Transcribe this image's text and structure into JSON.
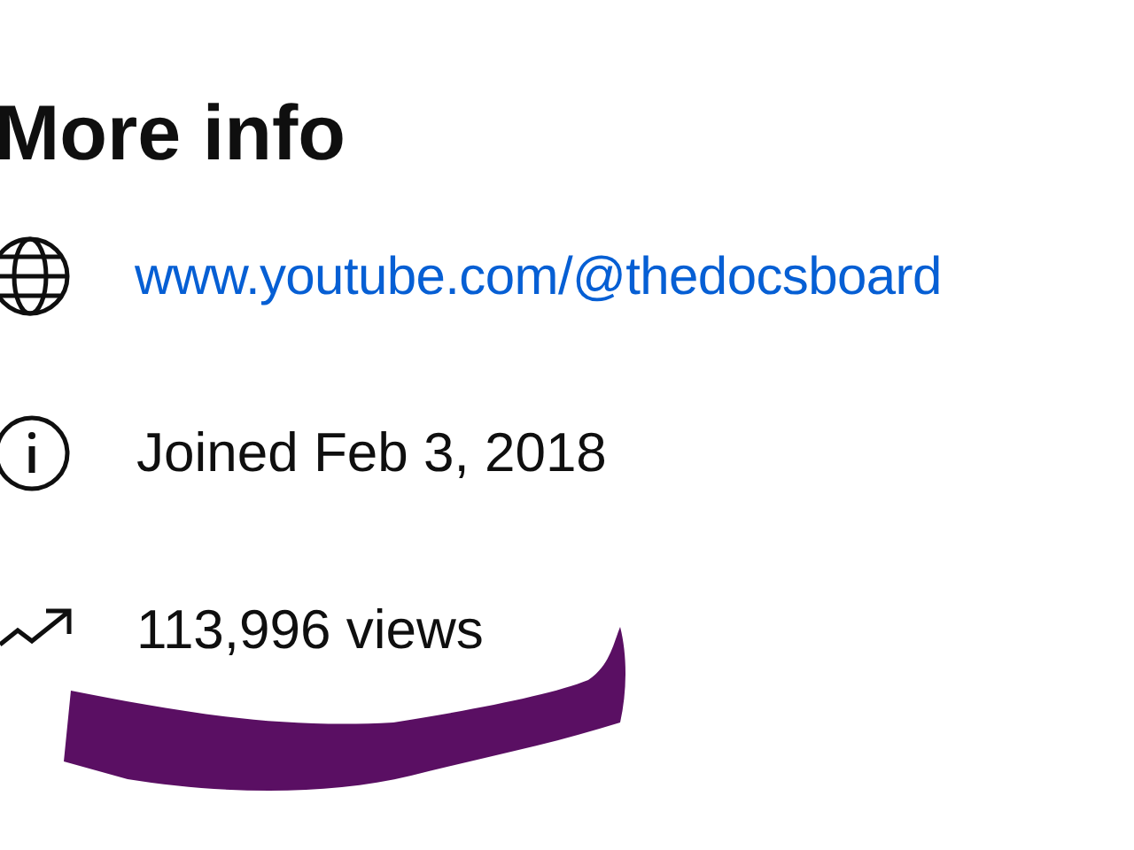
{
  "heading": "More info",
  "rows": [
    {
      "kind": "link",
      "text": "www.youtube.com/@thedocsboard"
    },
    {
      "kind": "info",
      "text": "Joined Feb 3, 2018"
    },
    {
      "kind": "views",
      "text": "113,996 views"
    }
  ]
}
